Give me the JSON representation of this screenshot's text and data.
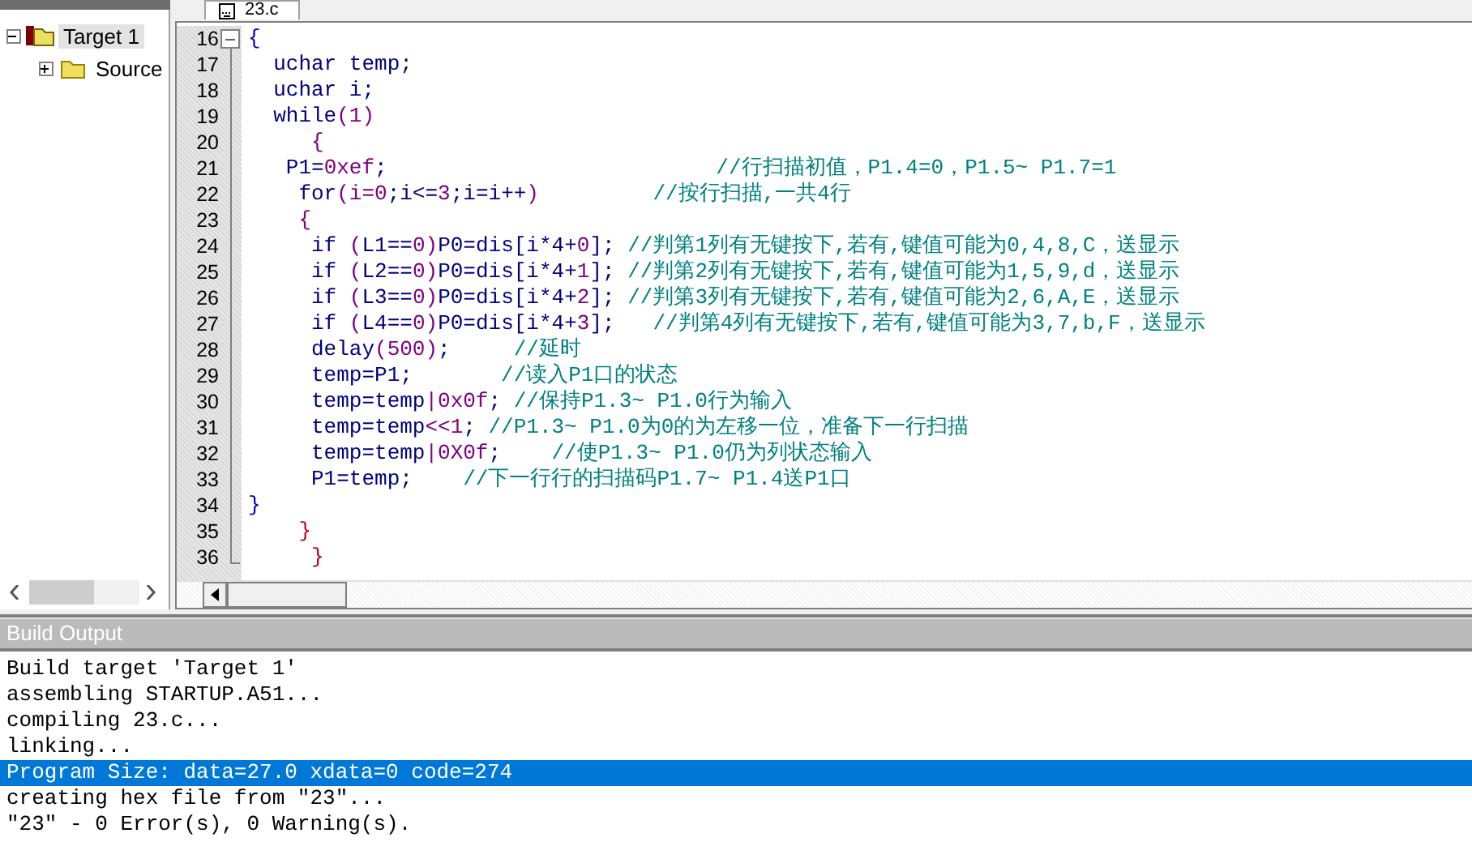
{
  "project_tree": [
    {
      "label": "Target 1",
      "expanded": true,
      "selected": true,
      "children": [
        {
          "label": "Source",
          "expanded": false,
          "selected": false
        }
      ]
    }
  ],
  "editor": {
    "tabs": [
      {
        "label": "23.c",
        "selected": true
      }
    ],
    "lines": [
      {
        "number": "16",
        "tokens": [
          {
            "kind": "brace",
            "text": "{"
          }
        ]
      },
      {
        "number": "17",
        "tokens": [
          {
            "kind": "code",
            "text": "  uchar temp;"
          }
        ]
      },
      {
        "number": "18",
        "tokens": [
          {
            "kind": "code",
            "text": "  uchar i;"
          }
        ]
      },
      {
        "number": "19",
        "tokens": [
          {
            "kind": "code",
            "text": "  while"
          },
          {
            "kind": "num",
            "text": "(1)"
          }
        ]
      },
      {
        "number": "20",
        "tokens": [
          {
            "kind": "num",
            "text": "     {"
          }
        ]
      },
      {
        "number": "21",
        "tokens": [
          {
            "kind": "code",
            "text": "   P1="
          },
          {
            "kind": "num",
            "text": "0xef"
          },
          {
            "kind": "code",
            "text": ";"
          },
          {
            "kind": "comment",
            "text": "                          //行扫描初值，P1.4=0，P1.5~ P1.7=1"
          }
        ]
      },
      {
        "number": "22",
        "tokens": [
          {
            "kind": "code",
            "text": "    for"
          },
          {
            "kind": "num",
            "text": "(i=0"
          },
          {
            "kind": "code",
            "text": ";i<="
          },
          {
            "kind": "num",
            "text": "3"
          },
          {
            "kind": "code",
            "text": ";i=i++"
          },
          {
            "kind": "num",
            "text": ")"
          },
          {
            "kind": "comment",
            "text": "         //按行扫描,一共4行"
          }
        ]
      },
      {
        "number": "23",
        "tokens": [
          {
            "kind": "num",
            "text": "    {"
          }
        ]
      },
      {
        "number": "24",
        "tokens": [
          {
            "kind": "code",
            "text": "     if "
          },
          {
            "kind": "num",
            "text": "("
          },
          {
            "kind": "code",
            "text": "L1=="
          },
          {
            "kind": "num",
            "text": "0)"
          },
          {
            "kind": "code",
            "text": "P0=dis[i*4+"
          },
          {
            "kind": "num",
            "text": "0"
          },
          {
            "kind": "code",
            "text": "];"
          },
          {
            "kind": "comment",
            "text": " //判第1列有无键按下,若有,键值可能为0,4,8,C，送显示"
          }
        ]
      },
      {
        "number": "25",
        "tokens": [
          {
            "kind": "code",
            "text": "     if "
          },
          {
            "kind": "num",
            "text": "("
          },
          {
            "kind": "code",
            "text": "L2=="
          },
          {
            "kind": "num",
            "text": "0)"
          },
          {
            "kind": "code",
            "text": "P0=dis[i*4+"
          },
          {
            "kind": "num",
            "text": "1"
          },
          {
            "kind": "code",
            "text": "];"
          },
          {
            "kind": "comment",
            "text": " //判第2列有无键按下,若有,键值可能为1,5,9,d，送显示"
          }
        ]
      },
      {
        "number": "26",
        "tokens": [
          {
            "kind": "code",
            "text": "     if "
          },
          {
            "kind": "num",
            "text": "("
          },
          {
            "kind": "code",
            "text": "L3=="
          },
          {
            "kind": "num",
            "text": "0)"
          },
          {
            "kind": "code",
            "text": "P0=dis[i*4+"
          },
          {
            "kind": "num",
            "text": "2"
          },
          {
            "kind": "code",
            "text": "];"
          },
          {
            "kind": "comment",
            "text": " //判第3列有无键按下,若有,键值可能为2,6,A,E，送显示"
          }
        ]
      },
      {
        "number": "27",
        "tokens": [
          {
            "kind": "code",
            "text": "     if "
          },
          {
            "kind": "num",
            "text": "("
          },
          {
            "kind": "code",
            "text": "L4=="
          },
          {
            "kind": "num",
            "text": "0)"
          },
          {
            "kind": "code",
            "text": "P0=dis[i*4+"
          },
          {
            "kind": "num",
            "text": "3"
          },
          {
            "kind": "code",
            "text": "];"
          },
          {
            "kind": "comment",
            "text": "   //判第4列有无键按下,若有,键值可能为3,7,b,F，送显示"
          }
        ]
      },
      {
        "number": "28",
        "tokens": [
          {
            "kind": "code",
            "text": "     delay"
          },
          {
            "kind": "num",
            "text": "(500)"
          },
          {
            "kind": "code",
            "text": ";"
          },
          {
            "kind": "comment",
            "text": "     //延时"
          }
        ]
      },
      {
        "number": "29",
        "tokens": [
          {
            "kind": "code",
            "text": "     temp=P1;"
          },
          {
            "kind": "comment",
            "text": "       //读入P1口的状态"
          }
        ]
      },
      {
        "number": "30",
        "tokens": [
          {
            "kind": "code",
            "text": "     temp=temp"
          },
          {
            "kind": "num",
            "text": "|0x0f"
          },
          {
            "kind": "code",
            "text": ";"
          },
          {
            "kind": "comment",
            "text": " //保持P1.3~ P1.0行为输入"
          }
        ]
      },
      {
        "number": "31",
        "tokens": [
          {
            "kind": "code",
            "text": "     temp=temp"
          },
          {
            "kind": "num",
            "text": "<<1"
          },
          {
            "kind": "code",
            "text": ";"
          },
          {
            "kind": "comment",
            "text": " //P1.3~ P1.0为0的为左移一位，准备下一行扫描"
          }
        ]
      },
      {
        "number": "32",
        "tokens": [
          {
            "kind": "code",
            "text": "     temp=temp"
          },
          {
            "kind": "num",
            "text": "|0X0f"
          },
          {
            "kind": "code",
            "text": ";"
          },
          {
            "kind": "comment",
            "text": "    //使P1.3~ P1.0仍为列状态输入"
          }
        ]
      },
      {
        "number": "33",
        "tokens": [
          {
            "kind": "code",
            "text": "     P1=temp;"
          },
          {
            "kind": "comment",
            "text": "    //下一行行的扫描码P1.7~ P1.4送P1口"
          }
        ]
      },
      {
        "number": "34",
        "tokens": [
          {
            "kind": "brace",
            "text": "}"
          }
        ]
      },
      {
        "number": "35",
        "tokens": [
          {
            "kind": "close",
            "text": "    }"
          }
        ]
      },
      {
        "number": "36",
        "tokens": [
          {
            "kind": "close",
            "text": "     }"
          }
        ]
      }
    ]
  },
  "build_output": {
    "title": "Build Output",
    "lines": [
      {
        "text": "Build target 'Target 1'",
        "selected": false
      },
      {
        "text": "assembling STARTUP.A51...",
        "selected": false
      },
      {
        "text": "compiling 23.c...",
        "selected": false
      },
      {
        "text": "linking...",
        "selected": false
      },
      {
        "text": "Program Size: data=27.0 xdata=0 code=274",
        "selected": true
      },
      {
        "text": "creating hex file from \"23\"...",
        "selected": false
      },
      {
        "text": "\"23\" - 0 Error(s), 0 Warning(s).",
        "selected": false
      }
    ]
  }
}
